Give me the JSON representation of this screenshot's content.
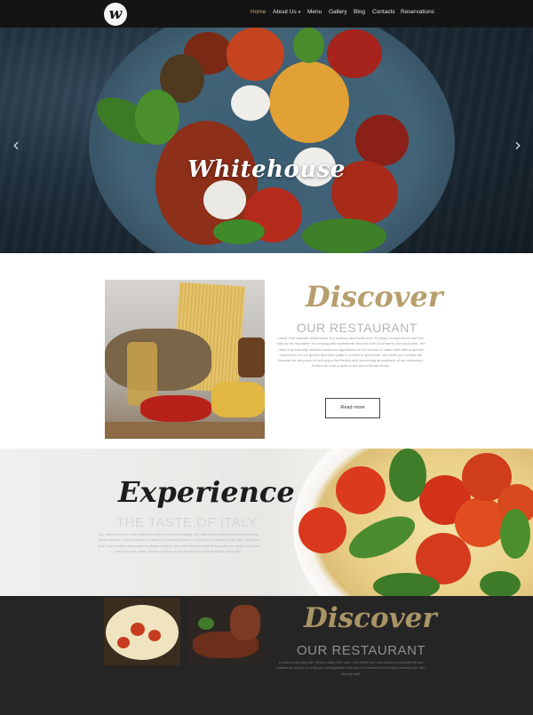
{
  "nav": {
    "logo_letter": "w",
    "items": [
      "Home",
      "About Us",
      "Menu",
      "Gallery",
      "Blog",
      "Contacts",
      "Reservations"
    ]
  },
  "hero": {
    "title": "Whitehouse",
    "prev_arrow": "‹",
    "next_arrow": "›"
  },
  "discover": {
    "title": "Discover",
    "subtitle": "OUR RESTAURANT",
    "body": "Head Chef Michael Whitehouse is a culinary talent with over 20 years of experience and has built up his reputation on cooking with ingredients sourced from local farms and producers. We have only carefully selected seasonal ingredients on our menus to make each dish a special experience for our guests and each plate is cooked to perfection. We invite you to taste the flavours we are proud of and enjoy the friendly and welcoming atmosphere of our restaurant. Perfect for both a quick lunch and a formal dinner.",
    "button": "Read more"
  },
  "experience": {
    "title": "Experience",
    "subtitle": "THE TASTE OF ITALY",
    "body": "Our restaurant and chef make the most of our surroundings. We offer dishes with the best in local and Italian flavours, plus the finest of wines to compliment them. Every dish is prepared with care using the best local produce and authentic Italian recipes. Discover the true taste of Italy with our seasonal menu and enjoy the warm, friendly service we are known for in our beautiful restaurant."
  },
  "discover2": {
    "title": "Discover",
    "subtitle": "OUR RESTAURANT",
    "body": "A culinary journey with dishes made with care. Our chefs use local seasonal ingredients and traditional recipes to bring you unforgettable flavours in a relaxed and elegant atmosphere with friendly staff."
  },
  "colors": {
    "accent_gold": "#b79e6c",
    "nav_bg": "#141414",
    "dark_section_bg": "#252525"
  }
}
